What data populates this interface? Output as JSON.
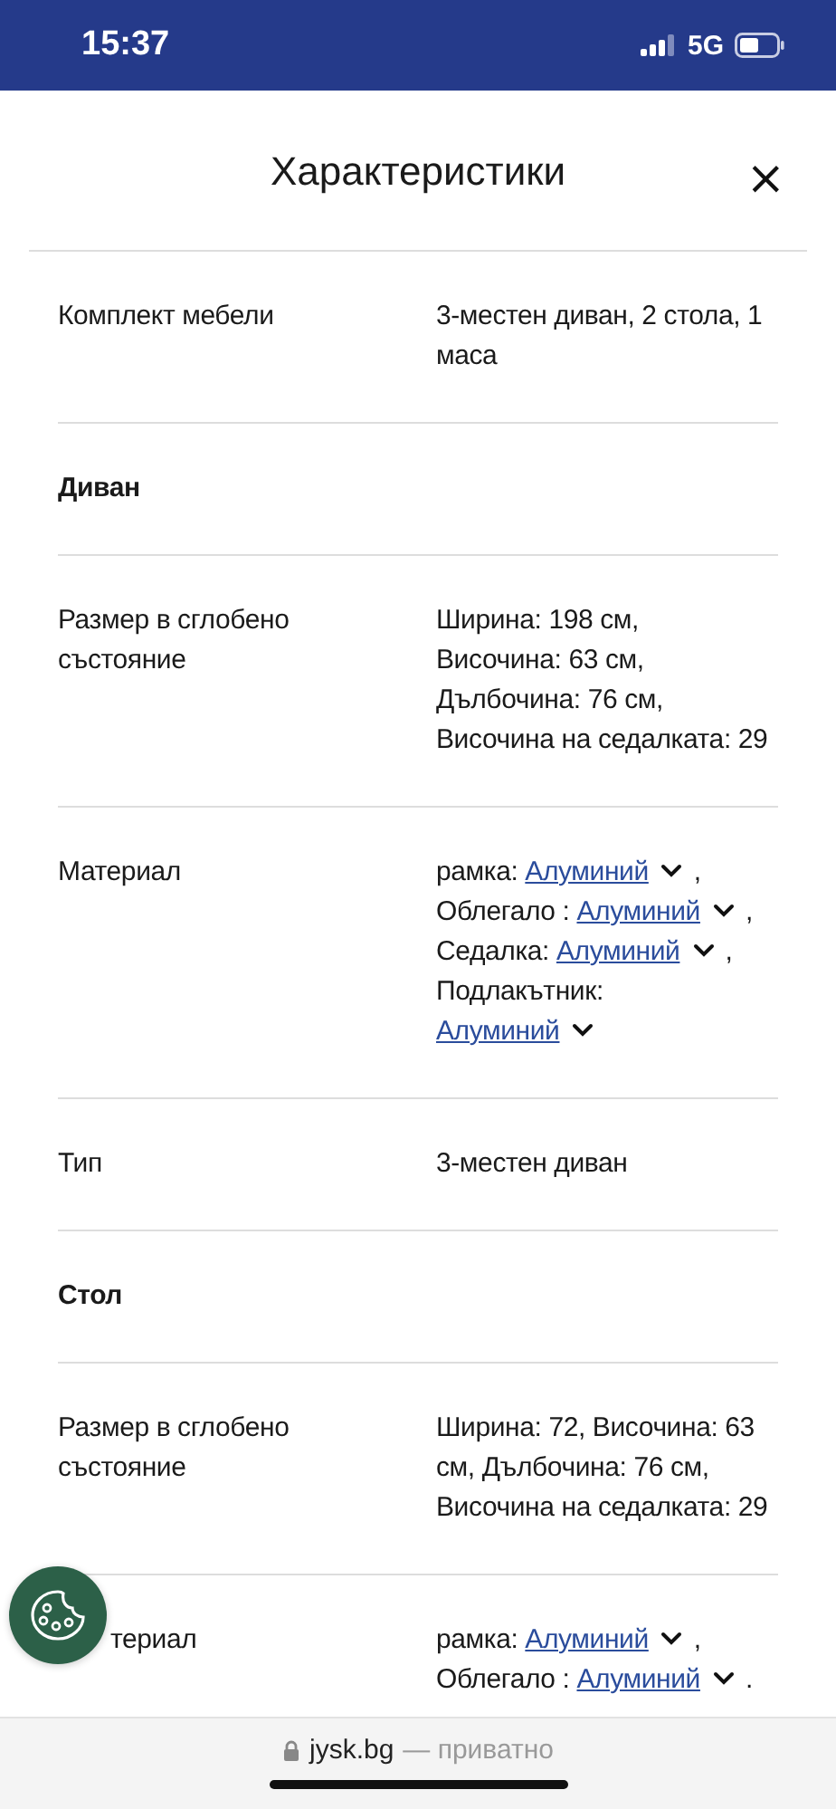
{
  "status_bar": {
    "time": "15:37",
    "network": "5G"
  },
  "dialog": {
    "title": "Характеристики",
    "close": "×"
  },
  "rows": [
    {
      "kind": "text",
      "label": "Комплект мебели",
      "value": "3-местен диван, 2 стола, 1 маса"
    },
    {
      "kind": "heading",
      "label": "Диван"
    },
    {
      "kind": "lines",
      "label": "Размер в сглобено състояние",
      "lines": [
        "Ширина: 198 см,",
        "Височина: 63 см,",
        "Дълбочина: 76 см,",
        "Височина на седалката: 29"
      ]
    },
    {
      "kind": "materials",
      "label": "Материал",
      "items": [
        {
          "part": "рамка:",
          "link": "Алуминий",
          "sep": ","
        },
        {
          "part": "Облегало :",
          "link": "Алуминий",
          "sep": ","
        },
        {
          "part": "Седалка:",
          "link": "Алуминий",
          "sep": ","
        },
        {
          "part": "Подлакътник:",
          "link": "Алуминий"
        }
      ]
    },
    {
      "kind": "text",
      "label": "Тип",
      "value": "3-местен диван"
    },
    {
      "kind": "heading",
      "label": "Стол"
    },
    {
      "kind": "text",
      "label": "Размер в сглобено състояние",
      "value": "Ширина: 72, Височина: 63 см, Дълбочина: 76 см, Височина на седалката: 29"
    },
    {
      "kind": "materials",
      "label": "териал",
      "covered": true,
      "items": [
        {
          "part": "рамка:",
          "link": "Алуминий",
          "sep": ","
        },
        {
          "part": "Облегало :",
          "link": "Алуминий",
          "sep": "."
        }
      ]
    }
  ],
  "browser_bar": {
    "domain": "jysk.bg",
    "note": "— приватно"
  }
}
